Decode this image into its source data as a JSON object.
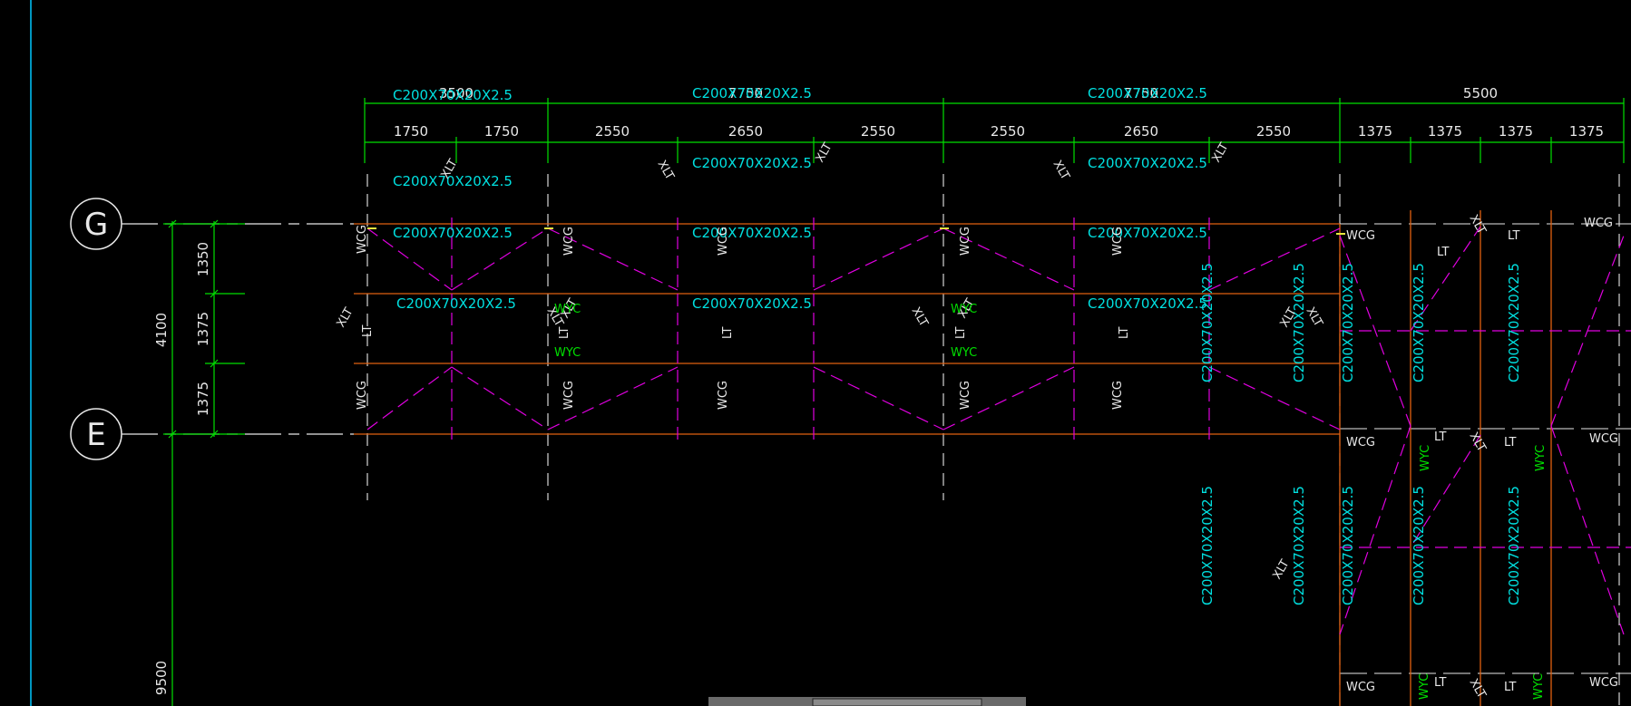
{
  "grid_axes": {
    "top": "G",
    "bottom": "E"
  },
  "dims": {
    "top_row": [
      "3500",
      "7750",
      "7750",
      "5500"
    ],
    "second_row": [
      "1750",
      "1750",
      "2550",
      "2650",
      "2550",
      "2550",
      "2650",
      "2550",
      "1375",
      "1375",
      "1375",
      "1375"
    ],
    "left_vertical": [
      "1350",
      "1375",
      "1375"
    ],
    "left_total": "4100",
    "left_lower": "9500"
  },
  "section": "C200X70X20X2.5",
  "labels": {
    "xlt": "XLT",
    "lt": "LT",
    "wcg": "WCG",
    "wyc": "WYC"
  },
  "colors": {
    "purlin": "#e06010",
    "brace": "#e000e0",
    "dimension": "#00e000",
    "section_text": "#00e0e0",
    "grid": "#e8e8e8",
    "border": "#00c8ff"
  }
}
